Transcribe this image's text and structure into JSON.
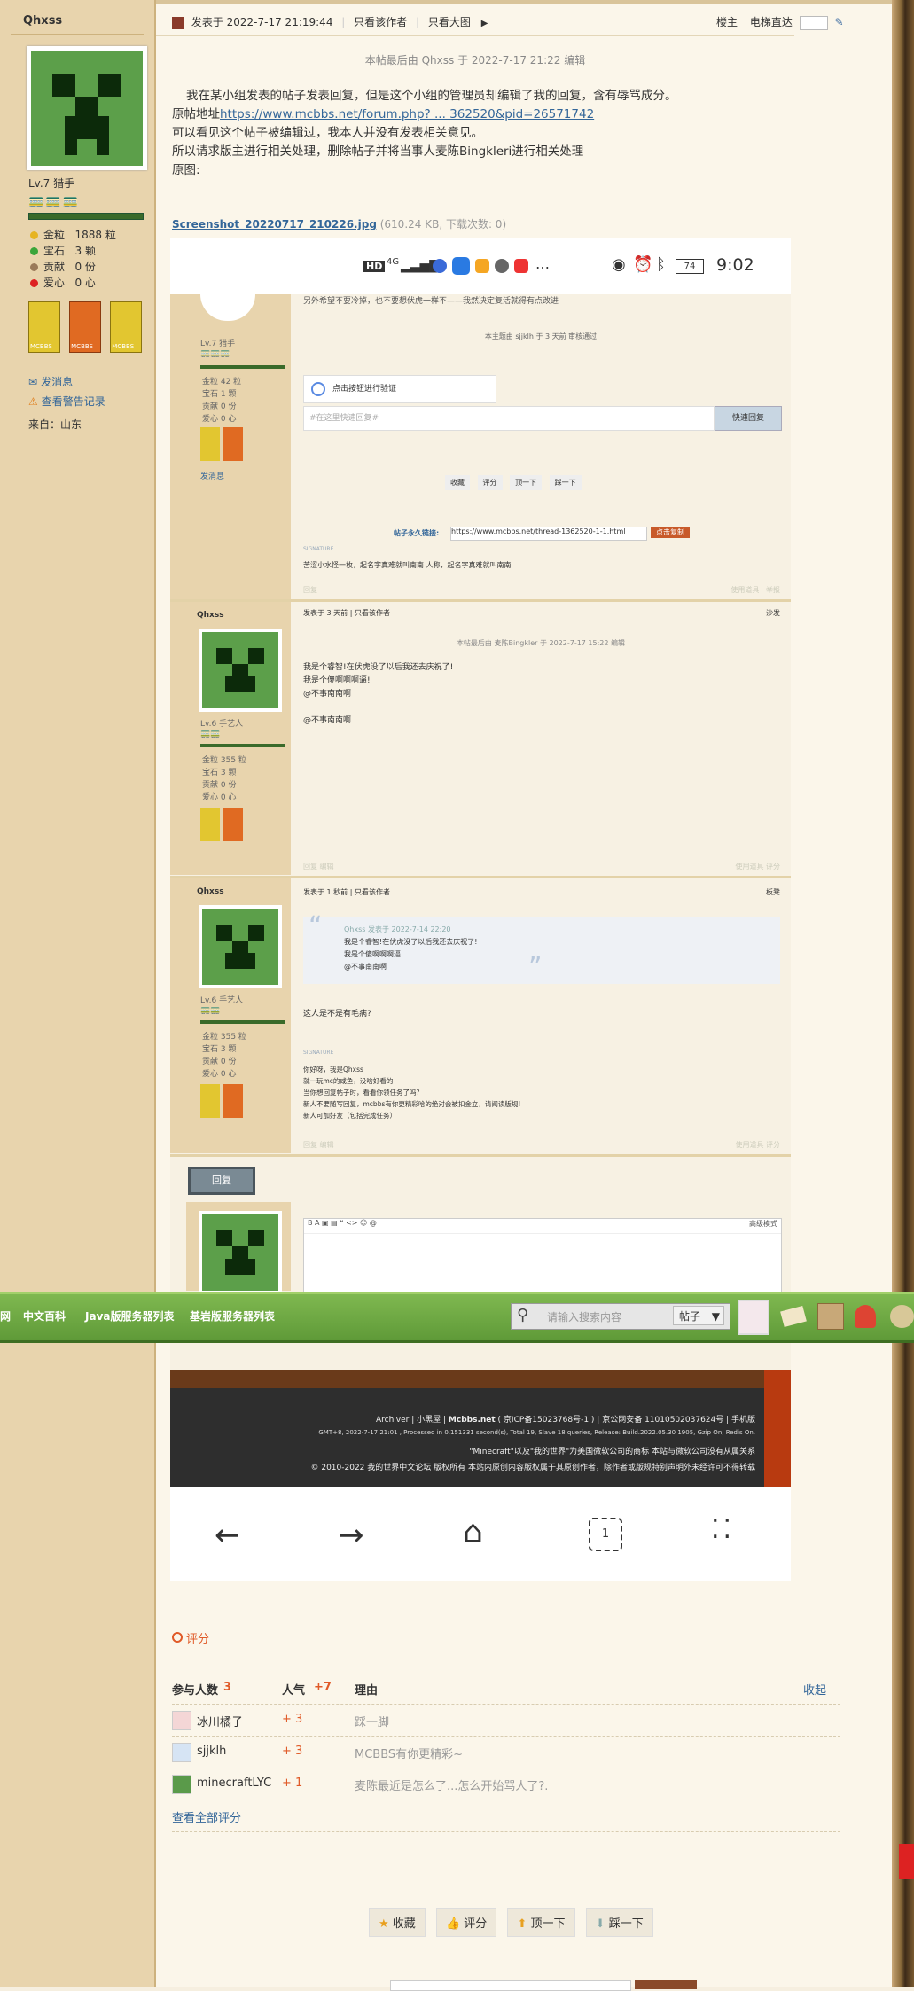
{
  "author": {
    "name": "Qhxss",
    "level": "Lv.7 猎手",
    "stats": [
      {
        "label": "金粒",
        "value": "1888 粒",
        "color": "#e6b422"
      },
      {
        "label": "宝石",
        "value": "3 颗",
        "color": "#3aa53a"
      },
      {
        "label": "贡献",
        "value": "0 份",
        "color": "#9a7a5a"
      },
      {
        "label": "爱心",
        "value": "0 心",
        "color": "#d22"
      }
    ],
    "badges": [
      "MCBBS",
      "MCBBS",
      "MCBBS"
    ],
    "send_message": "发消息",
    "warning_record": "查看警告记录",
    "from": "来自：山东"
  },
  "post_header": {
    "time": "发表于 2022-7-17 21:19:44",
    "only_author": "只看该作者",
    "big_image": "只看大图",
    "floor": "楼主",
    "elevator": "电梯直达"
  },
  "edit_note": "本帖最后由 Qhxss 于 2022-7-17 21:22 编辑",
  "body": {
    "line1": "我在某小组发表的帖子发表回复，但是这个小组的管理员却编辑了我的回复，含有辱骂成分。",
    "line2_prefix": "原帖地址",
    "line2_link": "https://www.mcbbs.net/forum.php? ... 362520&pid=26571742",
    "line3": "可以看见这个帖子被编辑过，我本人并没有发表相关意见。",
    "line4": "所以请求版主进行相关处理，删除帖子并将当事人麦陈Bingkleri进行相关处理",
    "line5": "原图:"
  },
  "attachment": {
    "name": "Screenshot_20220717_210226.jpg",
    "meta": "(610.24 KB, 下载次数: 0)"
  },
  "screenshot": {
    "status_time": "9:02",
    "battery": "74",
    "signal": "4G",
    "top_text": "另外希望不要冷掉，也不要想伏虎一样不——我然决定复活就得有点改进",
    "review": "本主题由 sjjklh 于 3 天前 审核通过",
    "p1_level": "Lv.7 猎手",
    "p1_stats": [
      "金粒 42 粒",
      "宝石 1 颗",
      "贡献 0 份",
      "爱心 0 心"
    ],
    "p1_msg": "发消息",
    "verify": "点击按钮进行验证",
    "quick_placeholder": "#在这里快速回复#",
    "quick_btn": "快速回复",
    "actions": [
      "收藏",
      "评分",
      "顶一下",
      "踩一下"
    ],
    "signature_label": "SIGNATURE",
    "permalink_label": "帖子永久链接:",
    "permalink": "https://www.mcbbs.net/thread-1362520-1-1.html",
    "copy_btn": "点击复制",
    "sig1": "苦涩小水怪一枚，起名字真难就叫南南 人称，起名字真难就叫南南",
    "row_actions": [
      "回复",
      "使用道具",
      "举报"
    ],
    "p2_name": "Qhxss",
    "p2_time": "发表于 3 天前",
    "p2_only": "只看该作者",
    "p2_floor": "沙发",
    "p2_edit": "本帖最后由 麦陈Bingkler 于 2022-7-17 15:22 编辑",
    "p2_lines": [
      "我是个睿智!在伏虎没了以后我还去庆祝了!",
      "我是个傻啊啊啊逼!",
      "@不事南南啊",
      "",
      "@不事南南啊"
    ],
    "p2_level": "Lv.6 手艺人",
    "p2_stats": [
      "金粒 355 粒",
      "宝石 3 颗",
      "贡献 0 份",
      "爱心 0 心"
    ],
    "p2_actions": [
      "回复",
      "编辑",
      "使用道具",
      "评分"
    ],
    "p3_name": "Qhxss",
    "p3_time": "发表于 1 秒前",
    "p3_only": "只看该作者",
    "p3_floor": "板凳",
    "quote_head": "Qhxss 发表于 2022-7-14 22:20",
    "quote_lines": [
      "我是个睿智!在伏虎没了以后我还去庆祝了!",
      "我是个傻啊啊啊逼!",
      "@不事南南啊"
    ],
    "p3_text": "这人是不是有毛病?",
    "p3_level": "Lv.6 手艺人",
    "p3_stats": [
      "金粒 355 粒",
      "宝石 3 颗",
      "贡献 0 份",
      "爱心 0 心"
    ],
    "sig3_label": "SIGNATURE",
    "sig3_lines": [
      "你好呀，我是Qhxss",
      "就一玩mc的咸鱼，没啥好看的",
      "当你想回复帖子时，看看你领任务了吗?",
      "新人不要随写回复，mcbbs有你更精彩哈的绝对会被扣金立，请阅读版规!",
      "新人可加好友（包括完成任务）"
    ],
    "p3_actions": [
      "回复",
      "编辑",
      "使用道具",
      "评分"
    ],
    "reply_btn": "回复",
    "editor_mode": "高级模式"
  },
  "navbar": {
    "items": [
      "网",
      "中文百科",
      "Java版服务器列表",
      "基岩版服务器列表"
    ],
    "search_placeholder": "请输入搜索内容",
    "search_scope": "帖子"
  },
  "footer": {
    "line1_parts": [
      "Archiver",
      "小黑屋",
      "Mcbbs.net",
      "( 京ICP备15023768号-1 ) |",
      "京公网安备 11010502037624号 | 手机版"
    ],
    "line2": "GMT+8, 2022-7-17 21:01 , Processed in 0.151331 second(s), Total 19, Slave 18 queries, Release: Build.2022.05.30 1905, Gzip On, Redis On.",
    "line3": "\"Minecraft\"以及\"我的世界\"为美国微软公司的商标 本站与微软公司没有从属关系",
    "line4": "© 2010-2022 我的世界中文论坛 版权所有 本站内原创内容版权属于其原创作者，除作者或版规特别声明外未经许可不得转载"
  },
  "ratings": {
    "title": "评分",
    "headers": {
      "participants": "参与人数",
      "participants_count": "3",
      "popularity": "人气",
      "popularity_total": "+7",
      "reason": "理由",
      "collapse": "收起"
    },
    "rows": [
      {
        "user": "冰川橘子",
        "score": "+ 3",
        "reason": "踩一脚"
      },
      {
        "user": "sjjklh",
        "score": "+ 3",
        "reason": "MCBBS有你更精彩~"
      },
      {
        "user": "minecraftLYC",
        "score": "+ 1",
        "reason": "麦陈最近是怎么了...怎么开始骂人了?."
      }
    ],
    "view_all": "查看全部评分"
  },
  "bottom_actions": [
    "收藏",
    "评分",
    "顶一下",
    "踩一下"
  ],
  "colors": {
    "accent": "#336699",
    "orange": "#e05a28",
    "nav_green": "#6aab40"
  }
}
